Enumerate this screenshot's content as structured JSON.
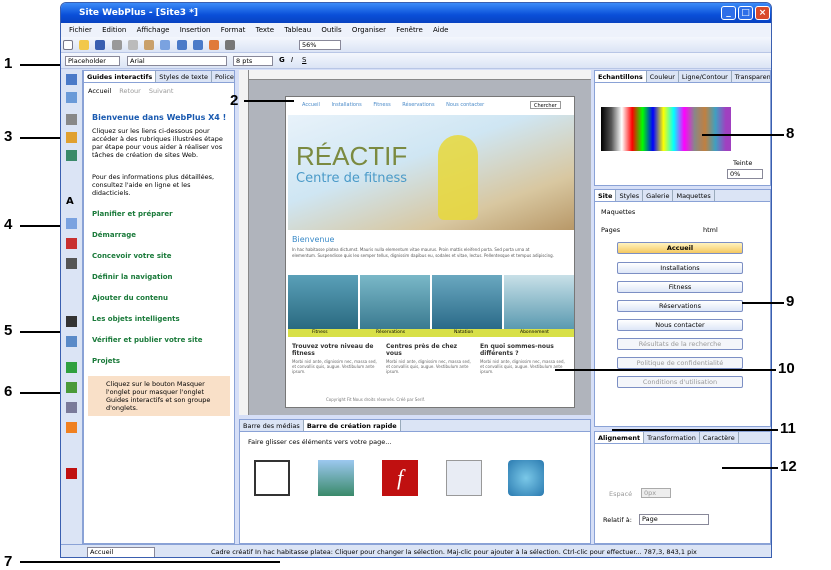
{
  "window": {
    "title": "Site WebPlus - [Site3 *]"
  },
  "menu": [
    "Fichier",
    "Edition",
    "Affichage",
    "Insertion",
    "Format",
    "Texte",
    "Tableau",
    "Outils",
    "Organiser",
    "Fenêtre",
    "Aide"
  ],
  "format_bar": {
    "style": "Placeholder",
    "font": "Arial",
    "size": "8 pts",
    "zoom": "56%"
  },
  "guides": {
    "tabs": [
      "Guides interactifs",
      "Styles de texte",
      "Polices"
    ],
    "nav": [
      "Accueil",
      "Retour",
      "Suivant"
    ],
    "heading": "Bienvenue dans WebPlus X4 !",
    "p1": "Cliquez sur les liens ci-dessous pour accéder à des rubriques illustrées étape par étape pour vous aider à réaliser vos tâches de création de sites Web.",
    "p2": "Pour des informations plus détaillées, consultez l'aide en ligne et les didacticiels.",
    "links": [
      "Planifier et préparer",
      "Démarrage",
      "Concevoir votre site",
      "Définir la navigation",
      "Ajouter du contenu",
      "Les objets intelligents",
      "Vérifier et publier votre site",
      "Projets"
    ],
    "tip": "Cliquez sur le bouton Masquer l'onglet pour masquer l'onglet Guides interactifs et son groupe d'onglets."
  },
  "canvas": {
    "nav": [
      "Accueil",
      "Installations",
      "Fitness",
      "Réservations",
      "Nous contacter"
    ],
    "search": "Chercher",
    "brand1": "RÉACTIF",
    "brand2": "Centre de fitness",
    "welcome": "Bienvenue",
    "body": "In hac habitasse platea dictumst. Mauris nulla elementum vitae maurus. Proin mattis eleifend porta. Sed porta urna at elementum. Suspendisse quis leo semper tellus, dignissim dapibus eu, sodales et vitae, lectus. Pellentesque et tempus adipiscing.",
    "thumbs": [
      "Fitness",
      "Réservations",
      "Natation",
      "Abonnement"
    ],
    "cols": [
      "Trouvez votre niveau de fitness",
      "Centres près de chez vous",
      "En quoi sommes-nous différents ?"
    ],
    "coltext": "Morbi nisl ante, dignissim nec, massa sed, et convallis quis, augue. Vestibulum ante ipsum.",
    "footer": "Copyright Fit Nous droits réservés. Créé par Serif."
  },
  "swatches": {
    "tabs": [
      "Echantillons",
      "Couleur",
      "Ligne/Contour",
      "Transparence"
    ],
    "teinte": "Teinte",
    "teinte_val": "0%"
  },
  "site": {
    "tabs": [
      "Site",
      "Styles",
      "Galerie",
      "Maquettes"
    ],
    "maquettes": "Maquettes",
    "pages_label": "Pages",
    "html": "html",
    "pages": [
      "Accueil",
      "Installations",
      "Fitness",
      "Réservations",
      "Nous contacter",
      "Résultats de la recherche",
      "Politique de confidentialité",
      "Conditions d'utilisation"
    ]
  },
  "bottom": {
    "tabs": [
      "Barre des médias",
      "Barre de création rapide"
    ],
    "hint": "Faire glisser ces éléments vers votre page..."
  },
  "align": {
    "tabs": [
      "Alignement",
      "Transformation",
      "Caractère"
    ],
    "spacing_label": "Espacé",
    "spacing_val": "0px",
    "relative_label": "Relatif à:",
    "relative_val": "Page"
  },
  "status": {
    "page": "Accueil",
    "text": "Cadre créatif In hac habitasse platea: Cliquer pour changer la sélection. Maj-clic pour ajouter à la sélection. Ctrl-clic pour effectuer... 787,3, 843,1 pix"
  },
  "callouts": [
    "1",
    "2",
    "3",
    "4",
    "5",
    "6",
    "7",
    "8",
    "9",
    "10",
    "11",
    "12"
  ]
}
